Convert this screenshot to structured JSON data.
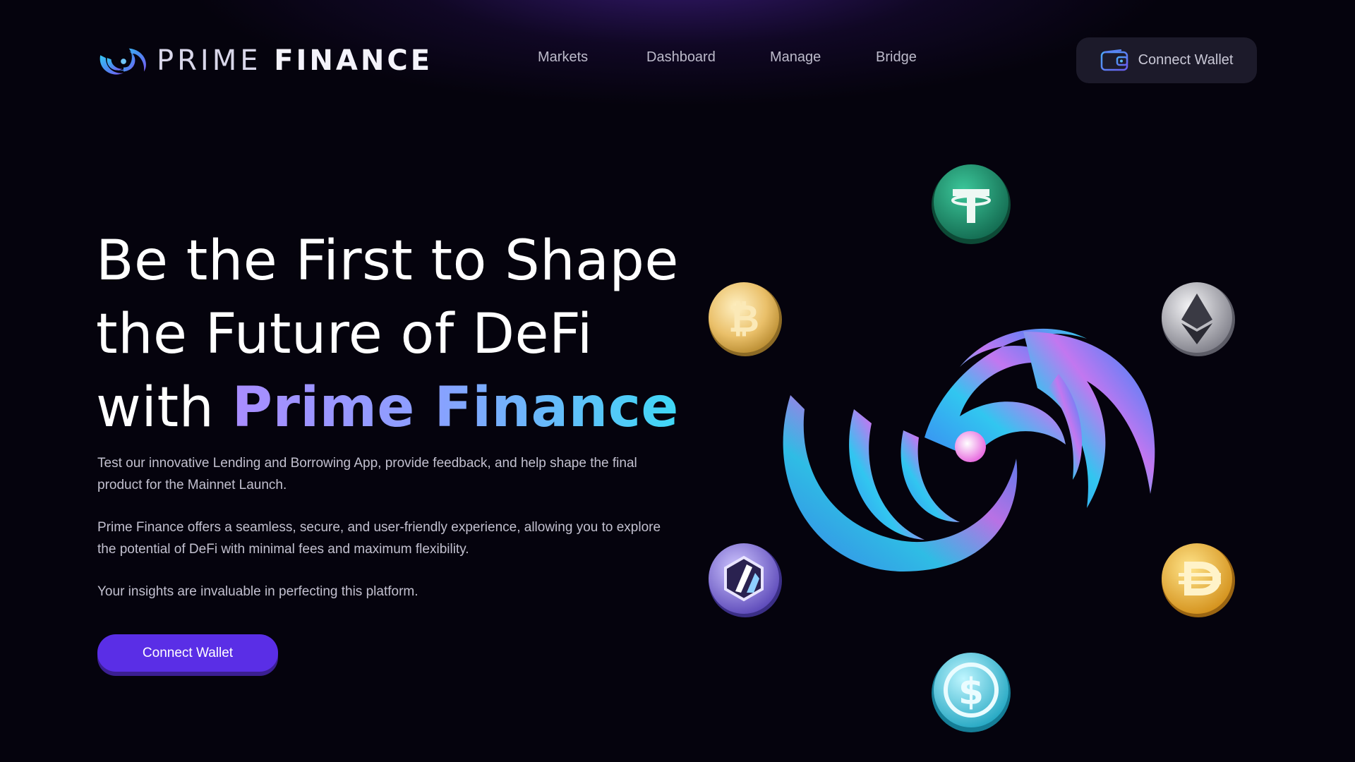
{
  "brand": {
    "name_part1": "PRIME",
    "name_part2": "FINANCE"
  },
  "nav": {
    "items": [
      {
        "label": "Markets"
      },
      {
        "label": "Dashboard"
      },
      {
        "label": "Manage"
      },
      {
        "label": "Bridge"
      }
    ]
  },
  "header_button": {
    "label": "Connect Wallet",
    "icon": "wallet-icon"
  },
  "hero": {
    "title_line1": "Be the First to Shape",
    "title_line2": "the Future of DeFi",
    "title_line3_prefix": "with",
    "title_line3_highlight": "Prime Finance",
    "paragraph1": "Test our innovative Lending and Borrowing App, provide feedback, and help shape the final product for the Mainnet Launch.",
    "paragraph2": "Prime Finance offers a seamless, secure, and user-friendly experience, allowing you to explore the potential of DeFi with minimal fees and maximum flexibility.",
    "paragraph3": "Your insights are invaluable in perfecting this platform.",
    "cta_label": "Connect Wallet"
  },
  "coins": [
    {
      "name": "tether-coin-icon",
      "color": "#1f8f6d"
    },
    {
      "name": "bitcoin-coin-icon",
      "color": "#e9b84e"
    },
    {
      "name": "ethereum-coin-icon",
      "color": "#a9a9b3"
    },
    {
      "name": "arbitrum-coin-icon",
      "color": "#7c6ad8"
    },
    {
      "name": "dai-coin-icon",
      "color": "#f0b23a"
    },
    {
      "name": "usdc-coin-icon",
      "color": "#2bc4d8"
    }
  ],
  "colors": {
    "background": "#05030d",
    "accent": "#5a2ee6",
    "gradient_start": "#a98dff",
    "gradient_end": "#3fd8f5"
  }
}
